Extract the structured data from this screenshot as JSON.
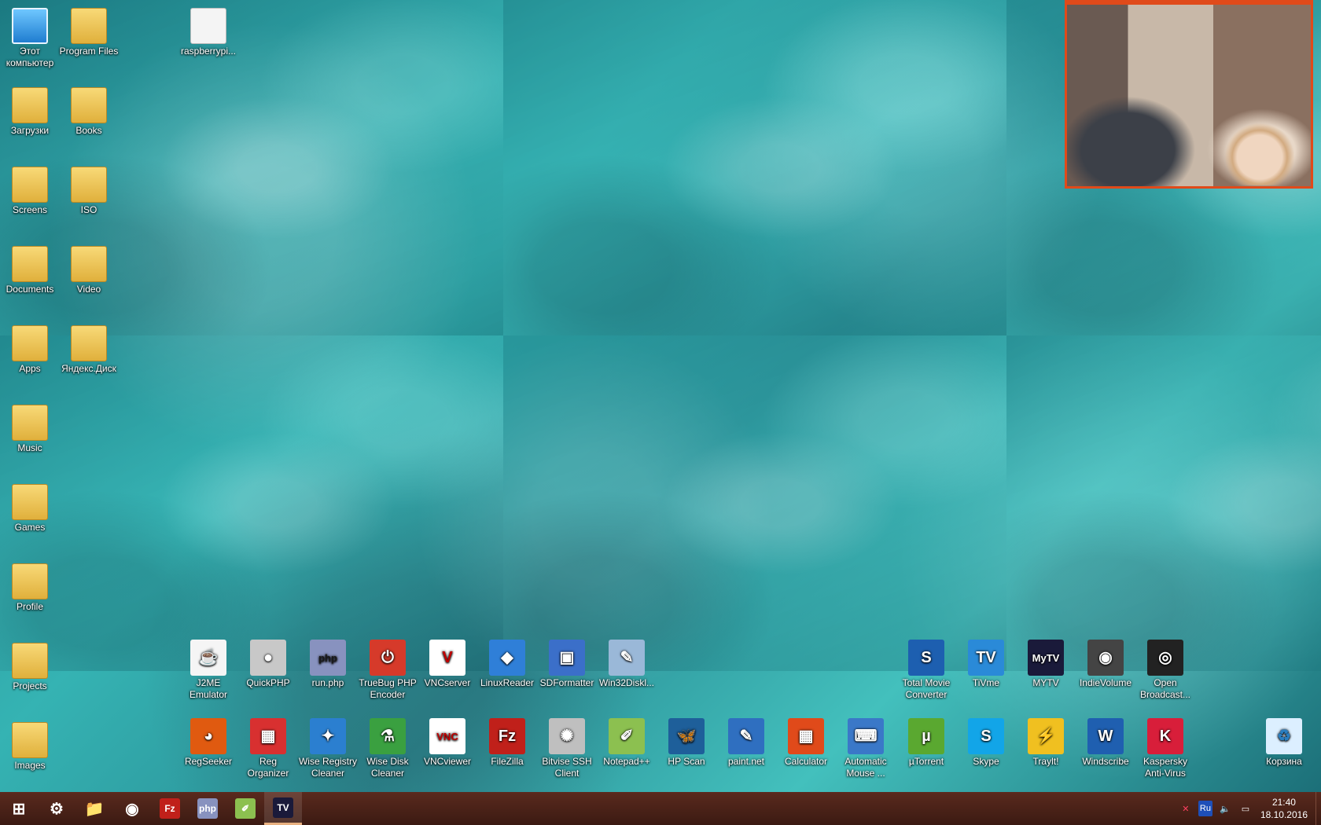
{
  "desktop": {
    "left_column": [
      {
        "label": "Этот компьютер",
        "icon": "computer-icon"
      },
      {
        "label": "Загрузки",
        "icon": "downloads-folder-icon"
      },
      {
        "label": "Screens",
        "icon": "folder-icon"
      },
      {
        "label": "Documents",
        "icon": "folder-icon"
      },
      {
        "label": "Apps",
        "icon": "folder-icon"
      },
      {
        "label": "Music",
        "icon": "folder-icon"
      },
      {
        "label": "Games",
        "icon": "folder-icon"
      },
      {
        "label": "Profile",
        "icon": "folder-icon"
      },
      {
        "label": "Projects",
        "icon": "folder-icon"
      },
      {
        "label": "Images",
        "icon": "folder-icon"
      }
    ],
    "second_column": [
      {
        "label": "Program Files",
        "icon": "folder-icon"
      },
      {
        "label": "Books",
        "icon": "chrome-folder-icon"
      },
      {
        "label": "ISO",
        "icon": "folder-icon"
      },
      {
        "label": "Video",
        "icon": "video-folder-icon"
      },
      {
        "label": "Яндекс.Диск",
        "icon": "yandex-disk-icon"
      }
    ],
    "top_extra": {
      "label": "raspberrypi...",
      "icon": "users-file-icon"
    },
    "row1": [
      {
        "label": "J2ME Emulator",
        "glyph": "☕",
        "bg": "#f5f5f5",
        "fg": "#d04020"
      },
      {
        "label": "QuickPHP",
        "glyph": "●",
        "bg": "#c8c8c8",
        "fg": "#ffffff"
      },
      {
        "label": "run.php",
        "glyph": "php",
        "bg": "#8892bf",
        "fg": "#1a1a1a"
      },
      {
        "label": "TrueBug PHP Encoder",
        "glyph": "⏻",
        "bg": "#d63a2a",
        "fg": "#ffffff"
      },
      {
        "label": "VNCserver",
        "glyph": "V",
        "bg": "#ffffff",
        "fg": "#c00000"
      },
      {
        "label": "LinuxReader",
        "glyph": "◆",
        "bg": "#2f7fd8",
        "fg": "#ffffff"
      },
      {
        "label": "SDFormatter",
        "glyph": "▣",
        "bg": "#3b6fc9",
        "fg": "#ffffff"
      },
      {
        "label": "Win32Diskl...",
        "glyph": "✎",
        "bg": "#9ab8d8",
        "fg": "#ffffff"
      },
      {
        "label": "Total Movie Converter",
        "glyph": "S",
        "bg": "#1d5fb0",
        "fg": "#ffffff"
      },
      {
        "label": "TiVme",
        "glyph": "TV",
        "bg": "#2a8ad8",
        "fg": "#ffffff"
      },
      {
        "label": "MYTV",
        "glyph": "MyTV",
        "bg": "#1a1a3a",
        "fg": "#ffffff"
      },
      {
        "label": "IndieVolume",
        "glyph": "◉",
        "bg": "#444444",
        "fg": "#ffffff"
      },
      {
        "label": "Open Broadcast...",
        "glyph": "◎",
        "bg": "#222222",
        "fg": "#ffffff"
      }
    ],
    "row2": [
      {
        "label": "RegSeeker",
        "glyph": "◕",
        "bg": "#e05a10",
        "fg": "#ffffff"
      },
      {
        "label": "Reg Organizer",
        "glyph": "▦",
        "bg": "#d83030",
        "fg": "#ffffff"
      },
      {
        "label": "Wise Registry Cleaner",
        "glyph": "✦",
        "bg": "#2b7fd0",
        "fg": "#ffffff"
      },
      {
        "label": "Wise Disk Cleaner",
        "glyph": "⚗",
        "bg": "#3aa040",
        "fg": "#ffffff"
      },
      {
        "label": "VNCviewer",
        "glyph": "VNC",
        "bg": "#ffffff",
        "fg": "#c00000"
      },
      {
        "label": "FileZilla",
        "glyph": "Fz",
        "bg": "#c0201a",
        "fg": "#ffffff"
      },
      {
        "label": "Bitvise SSH Client",
        "glyph": "✺",
        "bg": "#bfbfbf",
        "fg": "#ffffff"
      },
      {
        "label": "Notepad++",
        "glyph": "✐",
        "bg": "#8cc050",
        "fg": "#ffffff"
      },
      {
        "label": "HP Scan",
        "glyph": "🦋",
        "bg": "#1e5f9a",
        "fg": "#ffffff"
      },
      {
        "label": "paint.net",
        "glyph": "✎",
        "bg": "#2f6fc0",
        "fg": "#ffffff"
      },
      {
        "label": "Calculator",
        "glyph": "▦",
        "bg": "#e04a1a",
        "fg": "#ffffff"
      },
      {
        "label": "Automatic Mouse ...",
        "glyph": "⌨",
        "bg": "#3a78c8",
        "fg": "#ffffff"
      },
      {
        "label": "µTorrent",
        "glyph": "µ",
        "bg": "#5aa830",
        "fg": "#ffffff"
      },
      {
        "label": "Skype",
        "glyph": "S",
        "bg": "#12a5e8",
        "fg": "#ffffff"
      },
      {
        "label": "Traylt!",
        "glyph": "⚡",
        "bg": "#f0c020",
        "fg": "#c00000"
      },
      {
        "label": "Windscribe",
        "glyph": "W",
        "bg": "#1f5fb0",
        "fg": "#ffffff"
      },
      {
        "label": "Kaspersky Anti-Virus",
        "glyph": "K",
        "bg": "#d81e3a",
        "fg": "#ffffff"
      },
      {
        "label": "Корзина",
        "glyph": "♻",
        "bg": "#dcefff",
        "fg": "#2a7ec0"
      }
    ]
  },
  "taskbar": {
    "pinned": [
      {
        "name": "start-button",
        "icon": "windows-logo-icon",
        "glyph": "⊞"
      },
      {
        "name": "settings-button",
        "icon": "gear-icon",
        "glyph": "⚙"
      },
      {
        "name": "explorer-button",
        "icon": "folder-icon",
        "glyph": "📁"
      },
      {
        "name": "chrome-button",
        "icon": "chrome-icon",
        "glyph": "◉"
      },
      {
        "name": "filezilla-button",
        "icon": "filezilla-icon",
        "glyph": "Fz"
      },
      {
        "name": "php-button",
        "icon": "php-icon",
        "glyph": "php"
      },
      {
        "name": "notepadpp-button",
        "icon": "notepadpp-icon",
        "glyph": "✐"
      },
      {
        "name": "mytv-button",
        "icon": "mytv-icon",
        "glyph": "TV"
      }
    ],
    "tray": {
      "lang": "Ru",
      "time": "21:40",
      "date": "18.10.2016"
    }
  }
}
